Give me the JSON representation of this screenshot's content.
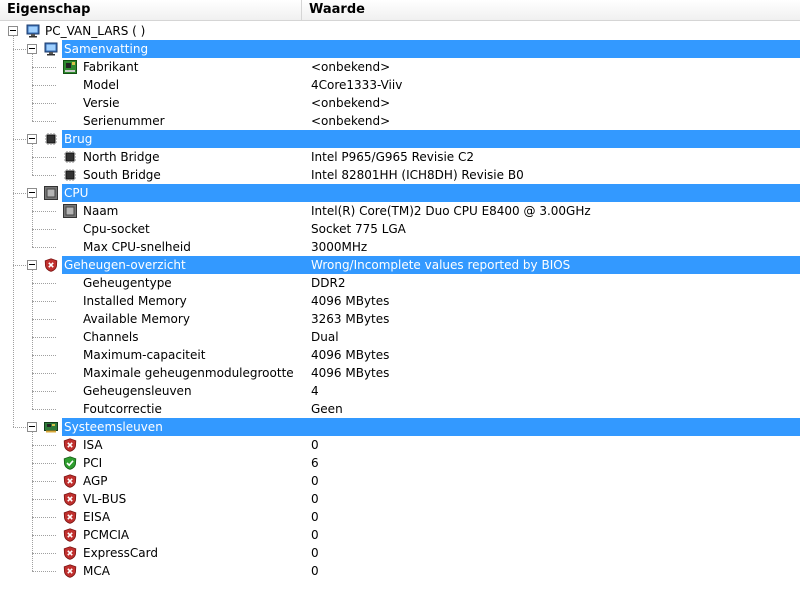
{
  "columns": {
    "property": "Eigenschap",
    "value": "Waarde"
  },
  "root": {
    "label": "PC_VAN_LARS ( )",
    "icon": "computer-icon"
  },
  "categories": [
    {
      "label": "Samenvatting",
      "value": "",
      "icon": "computer-icon",
      "items": [
        {
          "label": "Fabrikant",
          "value": "<onbekend>",
          "icon": "motherboard-icon"
        },
        {
          "label": "Model",
          "value": "4Core1333-Viiv",
          "icon": ""
        },
        {
          "label": "Versie",
          "value": "<onbekend>",
          "icon": ""
        },
        {
          "label": "Serienummer",
          "value": "<onbekend>",
          "icon": ""
        }
      ]
    },
    {
      "label": "Brug",
      "value": "",
      "icon": "chip-icon",
      "items": [
        {
          "label": "North Bridge",
          "value": "Intel P965/G965 Revisie C2",
          "icon": "chip-icon"
        },
        {
          "label": "South Bridge",
          "value": "Intel 82801HH (ICH8DH) Revisie B0",
          "icon": "chip-icon"
        }
      ]
    },
    {
      "label": "CPU",
      "value": "",
      "icon": "cpu-icon",
      "items": [
        {
          "label": "Naam",
          "value": "Intel(R) Core(TM)2 Duo CPU E8400 @ 3.00GHz",
          "icon": "cpu-icon"
        },
        {
          "label": "Cpu-socket",
          "value": "Socket 775 LGA",
          "icon": ""
        },
        {
          "label": "Max CPU-snelheid",
          "value": "3000MHz",
          "icon": ""
        }
      ]
    },
    {
      "label": "Geheugen-overzicht",
      "value": "Wrong/Incomplete values reported by BIOS",
      "icon": "shield-error-icon",
      "items": [
        {
          "label": "Geheugentype",
          "value": "DDR2",
          "icon": ""
        },
        {
          "label": "Installed Memory",
          "value": "4096 MBytes",
          "icon": ""
        },
        {
          "label": "Available Memory",
          "value": "3263 MBytes",
          "icon": ""
        },
        {
          "label": "Channels",
          "value": "Dual",
          "icon": ""
        },
        {
          "label": "Maximum-capaciteit",
          "value": "4096 MBytes",
          "icon": ""
        },
        {
          "label": "Maximale geheugenmodulegrootte",
          "value": "4096 MBytes",
          "icon": ""
        },
        {
          "label": "Geheugensleuven",
          "value": "4",
          "icon": ""
        },
        {
          "label": "Foutcorrectie",
          "value": "Geen",
          "icon": ""
        }
      ]
    },
    {
      "label": "Systeemsleuven",
      "value": "",
      "icon": "expansion-card-icon",
      "items": [
        {
          "label": "ISA",
          "value": "0",
          "icon": "shield-error-icon"
        },
        {
          "label": "PCI",
          "value": "6",
          "icon": "shield-ok-icon"
        },
        {
          "label": "AGP",
          "value": "0",
          "icon": "shield-error-icon"
        },
        {
          "label": "VL-BUS",
          "value": "0",
          "icon": "shield-error-icon"
        },
        {
          "label": "EISA",
          "value": "0",
          "icon": "shield-error-icon"
        },
        {
          "label": "PCMCIA",
          "value": "0",
          "icon": "shield-error-icon"
        },
        {
          "label": "ExpressCard",
          "value": "0",
          "icon": "shield-error-icon"
        },
        {
          "label": "MCA",
          "value": "0",
          "icon": "shield-error-icon"
        }
      ]
    }
  ],
  "colors": {
    "selection": "#3399ff",
    "ok": "#2e9e2e",
    "error": "#c0302e"
  }
}
